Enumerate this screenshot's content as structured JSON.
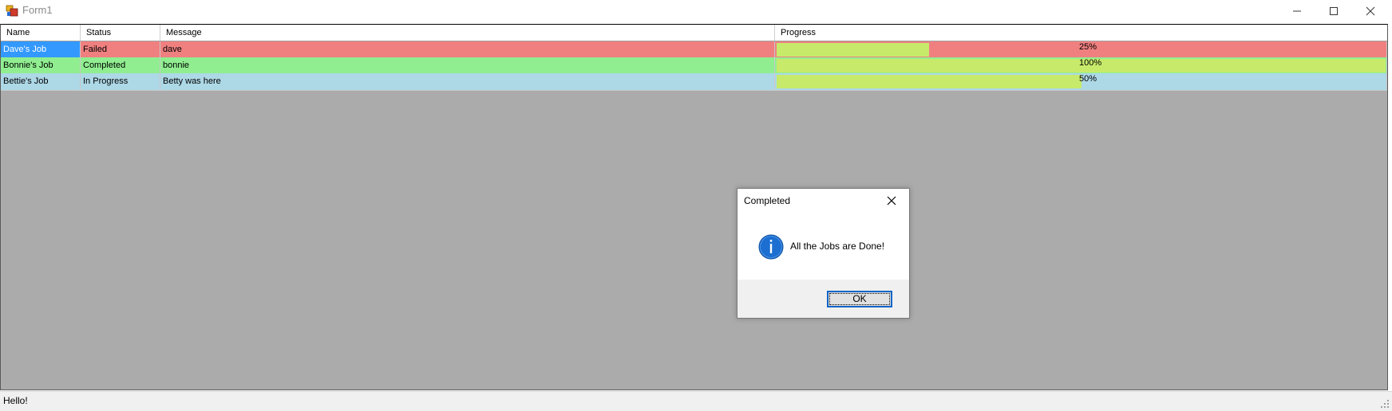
{
  "window": {
    "title": "Form1"
  },
  "grid": {
    "columns": [
      "Name",
      "Status",
      "Message",
      "Progress"
    ],
    "rows": [
      {
        "name": "Dave's Job",
        "status": "Failed",
        "message": "dave",
        "progress_label": "25%",
        "progress": 0.25,
        "row_color": "#f08080",
        "name_color": "#3399ff",
        "name_text_color": "#ffffff"
      },
      {
        "name": "Bonnie's Job",
        "status": "Completed",
        "message": "bonnie",
        "progress_label": "100%",
        "progress": 1.0,
        "row_color": "#90ee90",
        "name_color": "#90ee90",
        "name_text_color": "#000000"
      },
      {
        "name": "Bettie's Job",
        "status": "In Progress",
        "message": "Betty was here",
        "progress_label": "50%",
        "progress": 0.5,
        "row_color": "#add8e6",
        "name_color": "#add8e6",
        "name_text_color": "#000000"
      }
    ],
    "progress_bar_color": "#c7ea6b"
  },
  "statusbar": {
    "text": "Hello!"
  },
  "dialog": {
    "title": "Completed",
    "message": "All the Jobs are Done!",
    "ok_label": "OK",
    "icon": "info-icon"
  }
}
